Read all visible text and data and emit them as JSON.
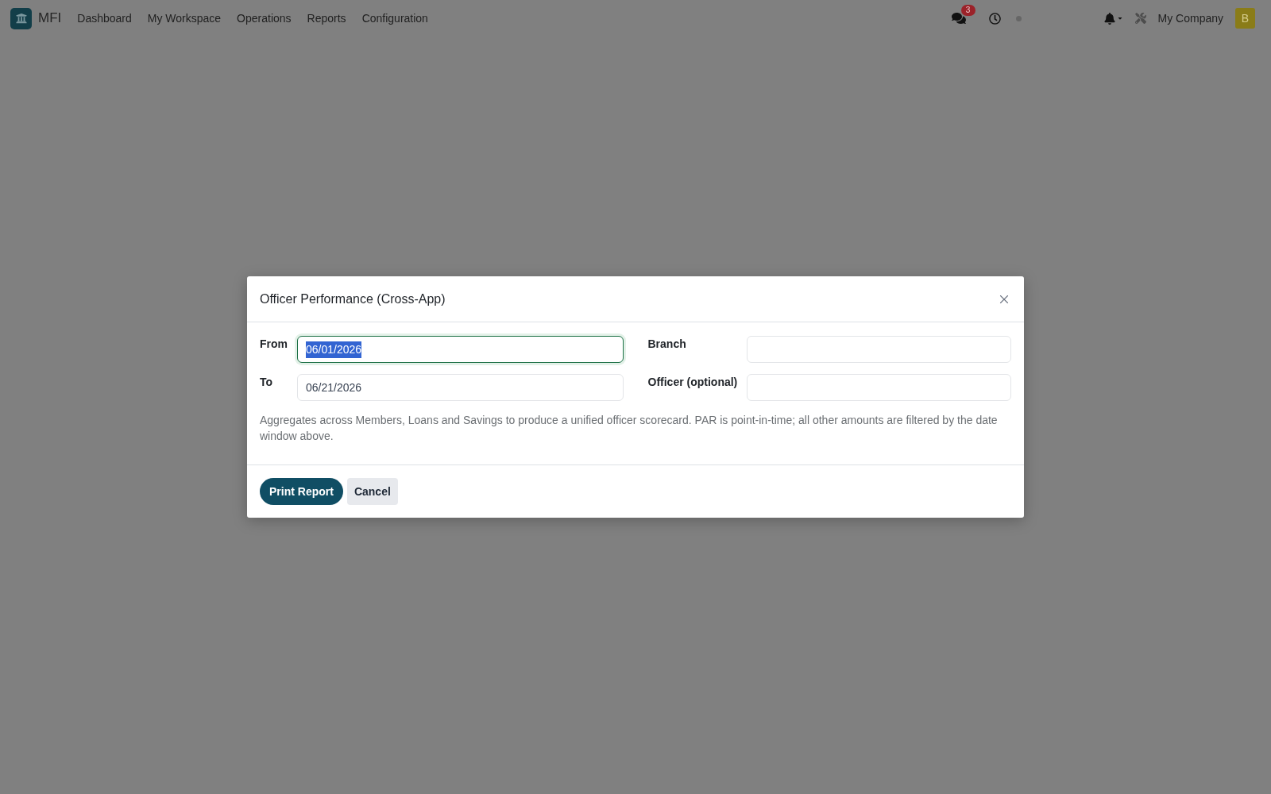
{
  "navbar": {
    "app_name": "MFI",
    "menu": [
      "Dashboard",
      "My Workspace",
      "Operations",
      "Reports",
      "Configuration"
    ],
    "messages_badge": "3",
    "company": "My Company",
    "avatar_initial": "B"
  },
  "dialog": {
    "title": "Officer Performance (Cross-App)",
    "field_columns": [
      {
        "fields": [
          {
            "label": "From",
            "value": "06/01/2026",
            "focused": true
          },
          {
            "label": "To",
            "value": "06/21/2026",
            "focused": false
          }
        ]
      },
      {
        "fields": [
          {
            "label": "Branch",
            "focused": false
          },
          {
            "label": "Officer (optional)",
            "focused": false
          }
        ]
      }
    ],
    "description": "Aggregates across Members, Loans and Savings to produce a unified officer scorecard. PAR is point-in-time; all other amounts are filtered by the date window above.",
    "buttons": [
      {
        "label": "Print Report",
        "kind": "primary"
      },
      {
        "label": "Cancel",
        "kind": "secondary"
      }
    ]
  }
}
